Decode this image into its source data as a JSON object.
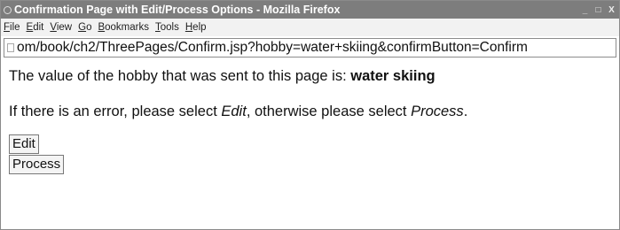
{
  "window": {
    "title": "Confirmation Page with Edit/Process Options - Mozilla Firefox",
    "controls": {
      "minimize": "_",
      "maximize": "□",
      "close": "X"
    }
  },
  "menu": {
    "items": [
      "File",
      "Edit",
      "View",
      "Go",
      "Bookmarks",
      "Tools",
      "Help"
    ]
  },
  "address_bar": {
    "url": "om/book/ch2/ThreePages/Confirm.jsp?hobby=water+skiing&confirmButton=Confirm"
  },
  "page": {
    "hobby_prefix": "The value of the hobby that was sent to this page is: ",
    "hobby_value": "water skiing",
    "instruction_part1": "If there is an error, please select ",
    "instruction_edit": "Edit",
    "instruction_part2": ", otherwise please select ",
    "instruction_process": "Process",
    "instruction_part3": ".",
    "edit_button": "Edit",
    "process_button": "Process"
  }
}
